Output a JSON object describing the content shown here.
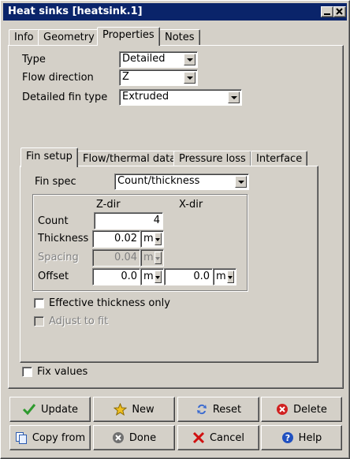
{
  "window": {
    "title": "Heat sinks [heatsink.1]"
  },
  "tabs": [
    {
      "label": "Info"
    },
    {
      "label": "Geometry"
    },
    {
      "label": "Properties",
      "active": true
    },
    {
      "label": "Notes"
    }
  ],
  "properties": {
    "type_label": "Type",
    "type_value": "Detailed",
    "flow_direction_label": "Flow direction",
    "flow_direction_value": "Z",
    "fin_type_label": "Detailed fin type",
    "fin_type_value": "Extruded"
  },
  "subtabs": [
    {
      "label": "Fin setup",
      "active": true
    },
    {
      "label": "Flow/thermal data"
    },
    {
      "label": "Pressure loss"
    },
    {
      "label": "Interface"
    }
  ],
  "fin_setup": {
    "fin_spec_label": "Fin spec",
    "fin_spec_value": "Count/thickness",
    "col_zdir": "Z-dir",
    "col_xdir": "X-dir",
    "count_label": "Count",
    "count_value": "4",
    "thickness_label": "Thickness",
    "thickness_value": "0.02",
    "thickness_unit": "m",
    "spacing_label": "Spacing",
    "spacing_value": "0.04",
    "spacing_unit": "m",
    "offset_label": "Offset",
    "offset_z_value": "0.0",
    "offset_z_unit": "m",
    "offset_x_value": "0.0",
    "offset_x_unit": "m",
    "effective_thickness_label": "Effective thickness only",
    "adjust_to_fit_label": "Adjust to fit"
  },
  "fix_values_label": "Fix values",
  "buttons": {
    "update": "Update",
    "new": "New",
    "reset": "Reset",
    "delete": "Delete",
    "copy_from": "Copy from",
    "done": "Done",
    "cancel": "Cancel",
    "help": "Help"
  },
  "colors": {
    "titlebar": "#0a246a",
    "face": "#d4d0c8",
    "update_check": "#2e9a2e",
    "cancel_x": "#d01010",
    "delete_red": "#d02020",
    "help_blue": "#2050c0",
    "new_star": "#f0c020"
  }
}
